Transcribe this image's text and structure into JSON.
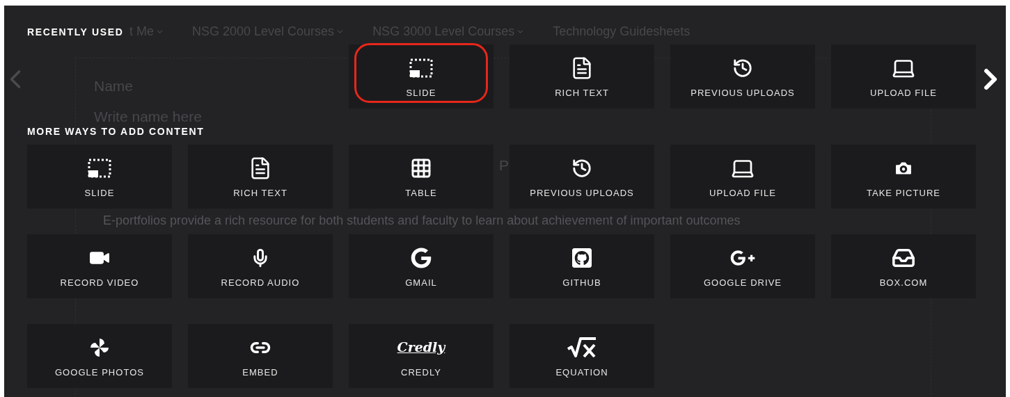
{
  "background_page": {
    "nav": [
      {
        "label": "t Me",
        "dropdown": true
      },
      {
        "label": "NSG 2000 Level Courses",
        "dropdown": true
      },
      {
        "label": "NSG 3000 Level Courses",
        "dropdown": true
      },
      {
        "label": "Technology Guidesheets",
        "dropdown": false
      }
    ],
    "name_label": "Name",
    "name_placeholder": "Write name here",
    "heading_fragment": "P",
    "paragraph": "E-portfolios provide a rich resource for both students and faculty to learn about achievement of important outcomes"
  },
  "recently_used": {
    "title": "RECENTLY USED",
    "items": [
      {
        "label": "SLIDE",
        "kind": "slide",
        "selected": true
      },
      {
        "label": "RICH TEXT",
        "kind": "document",
        "selected": false
      },
      {
        "label": "PREVIOUS UPLOADS",
        "kind": "history",
        "selected": false
      },
      {
        "label": "UPLOAD FILE",
        "kind": "laptop",
        "selected": false
      }
    ]
  },
  "more_ways": {
    "title": "MORE WAYS TO ADD CONTENT",
    "items": [
      {
        "label": "SLIDE",
        "kind": "slide"
      },
      {
        "label": "RICH TEXT",
        "kind": "document"
      },
      {
        "label": "TABLE",
        "kind": "table"
      },
      {
        "label": "PREVIOUS UPLOADS",
        "kind": "history"
      },
      {
        "label": "UPLOAD FILE",
        "kind": "laptop"
      },
      {
        "label": "TAKE PICTURE",
        "kind": "camera"
      },
      {
        "label": "RECORD VIDEO",
        "kind": "video"
      },
      {
        "label": "RECORD AUDIO",
        "kind": "microphone"
      },
      {
        "label": "GMAIL",
        "kind": "google"
      },
      {
        "label": "GITHUB",
        "kind": "github"
      },
      {
        "label": "GOOGLE DRIVE",
        "kind": "googleplus"
      },
      {
        "label": "BOX.COM",
        "kind": "inbox"
      },
      {
        "label": "GOOGLE PHOTOS",
        "kind": "pinwheel"
      },
      {
        "label": "EMBED",
        "kind": "link"
      },
      {
        "label": "CREDLY",
        "kind": "wordmark",
        "logo": "Credly"
      },
      {
        "label": "EQUATION",
        "kind": "sqrt"
      }
    ]
  }
}
